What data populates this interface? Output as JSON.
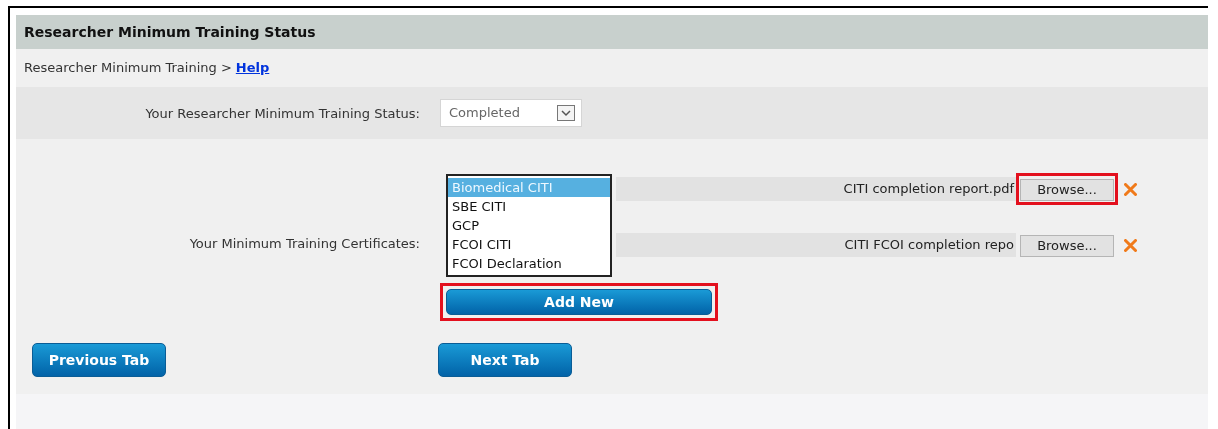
{
  "header": {
    "title": "Researcher Minimum Training Status"
  },
  "breadcrumb": {
    "path": "Researcher Minimum Training >",
    "link": "Help"
  },
  "status": {
    "label": "Your Researcher Minimum Training Status:",
    "value": "Completed"
  },
  "certificates": {
    "label": "Your Minimum Training Certificates:",
    "rows": [
      {
        "file": "CITI completion report.pdf",
        "browse": "Browse...",
        "highlighted": true
      },
      {
        "file": "CITI FCOI completion repo",
        "browse": "Browse...",
        "highlighted": false
      }
    ],
    "dropdown": {
      "options": [
        {
          "label": "Biomedical CITI",
          "selected": true
        },
        {
          "label": "SBE CITI",
          "selected": false
        },
        {
          "label": "GCP",
          "selected": false
        },
        {
          "label": "FCOI CITI",
          "selected": false
        },
        {
          "label": "FCOI Declaration",
          "selected": false
        }
      ]
    },
    "add_button": {
      "label": "Add New",
      "highlighted": true
    }
  },
  "nav": [
    {
      "label": "Previous Tab"
    },
    {
      "label": "Next Tab"
    }
  ]
}
